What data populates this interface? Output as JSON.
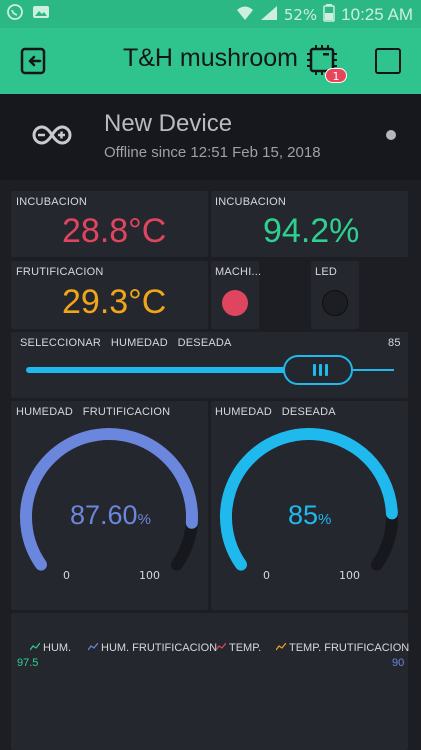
{
  "status": {
    "battery": "52%",
    "time": "10:25 AM"
  },
  "header": {
    "title": "T&H mushroom",
    "badge": "1"
  },
  "device": {
    "name": "New Device",
    "status": "Offline since 12:51 Feb 15, 2018"
  },
  "widgets": {
    "temp_incubacion": {
      "label": "INCUBACION",
      "value": "28.8°C",
      "color": "#e0455f"
    },
    "hum_incubacion": {
      "label": "INCUBACION",
      "value": "94.2%",
      "color": "#2fd08f"
    },
    "temp_frutificacion": {
      "label": "FRUTIFICACION",
      "value": "29.3°C",
      "color": "#f0a51a"
    },
    "machi_led": {
      "label": "MACHI...",
      "on": true,
      "color": "#e0455f"
    },
    "led": {
      "label": "LED",
      "on": false
    }
  },
  "slider": {
    "label": "SELECCIONAR   HUMEDAD   DESEADA",
    "max_label": "85",
    "value": 85,
    "fraction": 0.72
  },
  "gauges": [
    {
      "label": "HUMEDAD   FRUTIFICACION",
      "value": "87.60",
      "unit": "%",
      "min": "0",
      "max": "100",
      "fraction": 0.876,
      "color": "#6b86dd"
    },
    {
      "label": "HUMEDAD   DESEADA",
      "value": "85",
      "unit": "%",
      "min": "0",
      "max": "100",
      "fraction": 0.85,
      "color": "#1fb9ee"
    }
  ],
  "chart": {
    "legend": [
      {
        "label": "HUM.",
        "color": "#2fd08f"
      },
      {
        "label": "HUM. FRUTIFICACION",
        "color": "#6b86dd"
      },
      {
        "label": "TEMP.",
        "color": "#e0455f"
      },
      {
        "label": "TEMP. FRUTIFICACION",
        "color": "#f0a51a"
      }
    ],
    "left_value": "97.5",
    "right_value": "90"
  }
}
